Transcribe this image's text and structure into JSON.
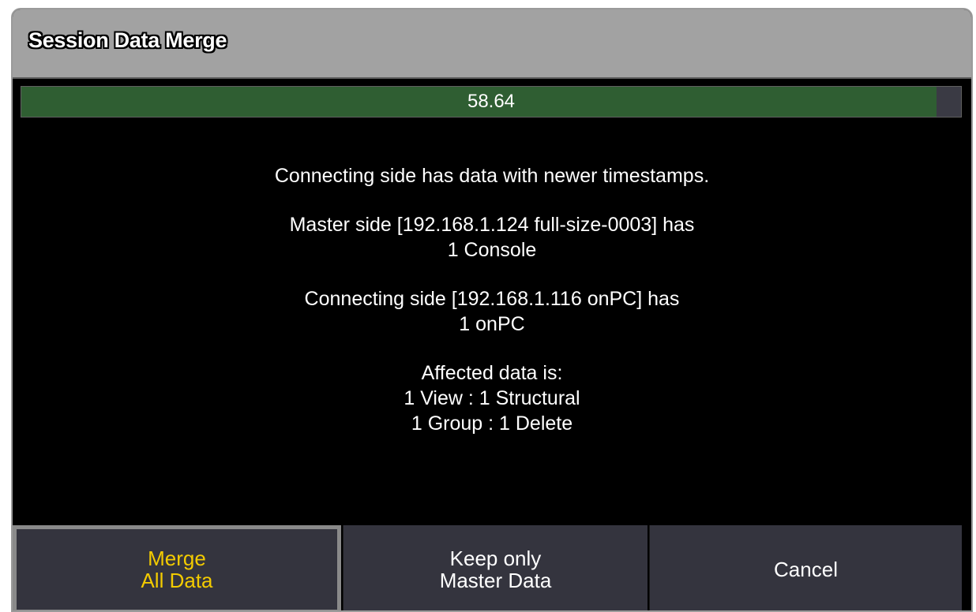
{
  "dialog": {
    "title": "Session Data Merge"
  },
  "progress": {
    "label": "58.64",
    "fill_color": "#2f5e32"
  },
  "message": {
    "summary": "Connecting side has data with newer timestamps.",
    "master_line1": "Master side [192.168.1.124 full-size-0003] has",
    "master_line2": "1 Console",
    "connecting_line1": "Connecting side [192.168.1.116 onPC] has",
    "connecting_line2": "1 onPC",
    "affected_header": "Affected data is:",
    "affected_line1": "1 View :  1 Structural",
    "affected_line2": "1 Group :  1 Delete"
  },
  "buttons": {
    "merge_line1": "Merge",
    "merge_line2": "All Data",
    "keep_line1": "Keep only",
    "keep_line2": "Master Data",
    "cancel": "Cancel"
  },
  "colors": {
    "title_bar": "#a2a2a2",
    "button_bg": "#34343e",
    "selected_text": "#f3cb00"
  }
}
